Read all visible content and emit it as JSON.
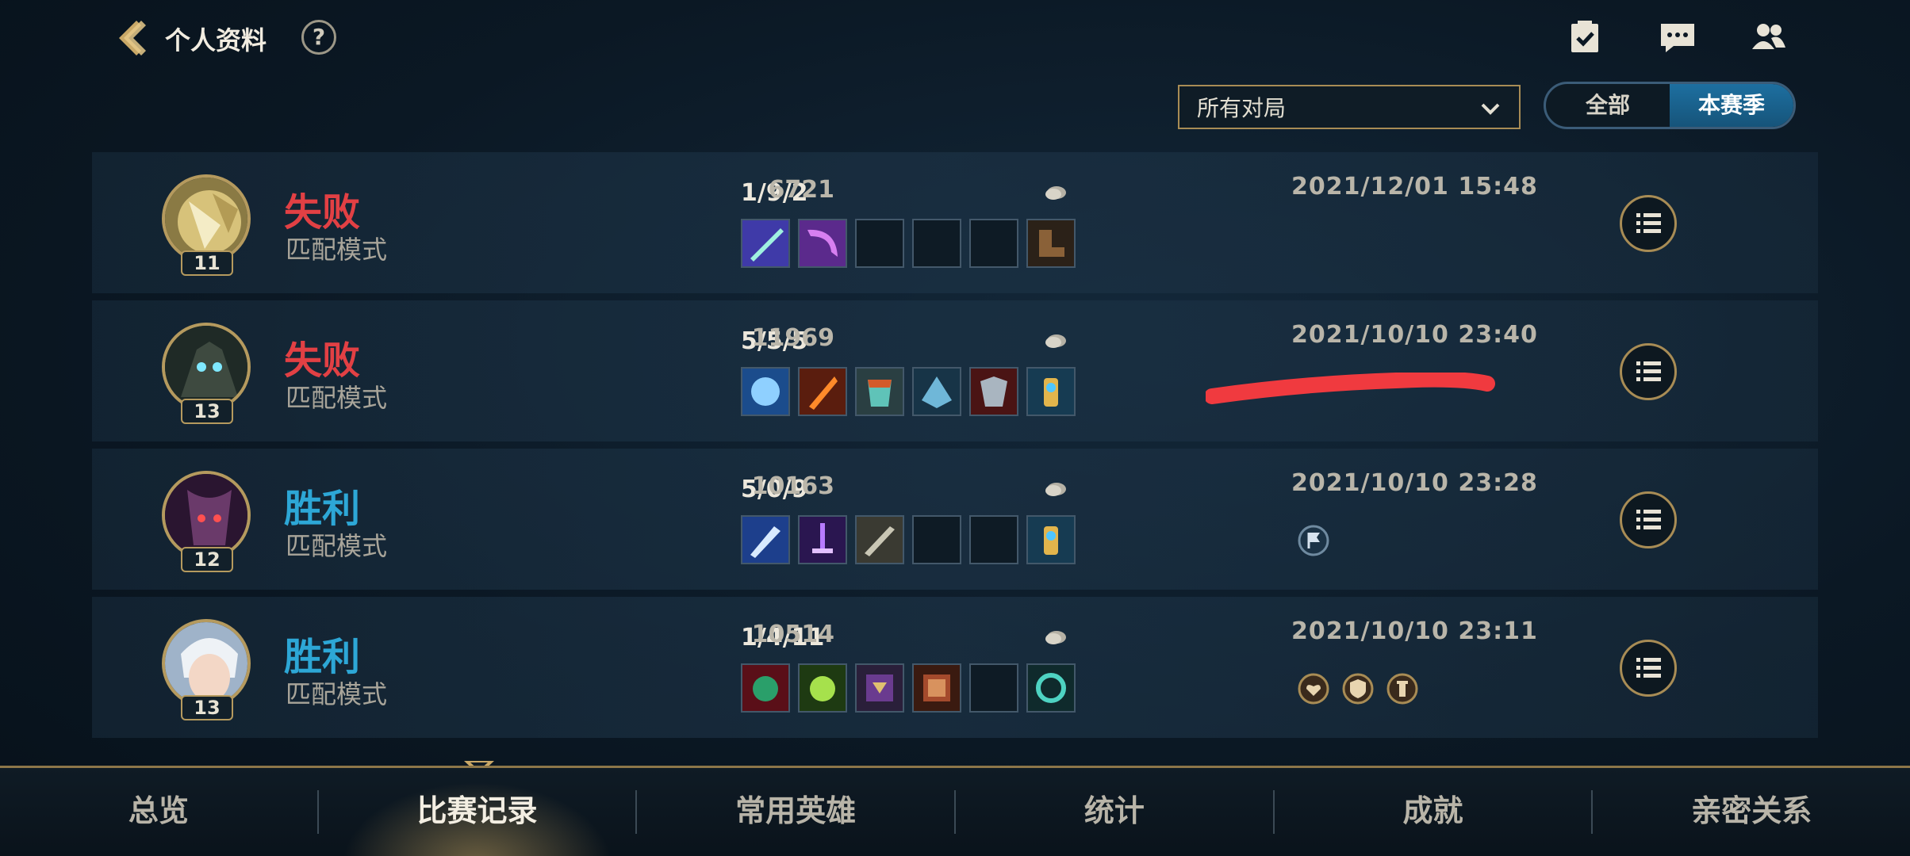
{
  "header": {
    "title": "个人资料",
    "help": "?"
  },
  "filter": {
    "selected": "所有对局",
    "season_options": [
      "全部",
      "本赛季"
    ],
    "season_active": "本赛季"
  },
  "matches": [
    {
      "result": "失败",
      "mode": "匹配模式",
      "level": "11",
      "kda": "1/9/2",
      "gold": "6721",
      "datetime": "2021/12/01 15:48",
      "items": [
        "item-blade-icon",
        "item-scythe-icon",
        "",
        "",
        "",
        "item-boots-icon"
      ],
      "badges": []
    },
    {
      "result": "失败",
      "mode": "匹配模式",
      "level": "13",
      "kda": "5/5/5",
      "gold": "11969",
      "datetime": "2021/10/10 23:40",
      "items": [
        "item-frost-gauntlet-icon",
        "item-flame-sword-icon",
        "item-scale-armor-icon",
        "item-ice-helm-icon",
        "item-red-armor-icon",
        "item-golden-trinket-icon"
      ],
      "badges": []
    },
    {
      "result": "胜利",
      "mode": "匹配模式",
      "level": "12",
      "kda": "5/0/9",
      "gold": "10163",
      "datetime": "2021/10/10 23:28",
      "items": [
        "item-crystal-blade-icon",
        "item-void-sword-icon",
        "item-longsword-icon",
        "",
        "",
        "item-golden-trinket-icon"
      ],
      "badges": [
        "flag-badge-icon"
      ]
    },
    {
      "result": "胜利",
      "mode": "匹配模式",
      "level": "13",
      "kda": "1/4/11",
      "gold": "10514",
      "datetime": "2021/10/10 23:11",
      "items": [
        "item-demon-mask-icon",
        "item-green-orb-icon",
        "item-purple-tome-icon",
        "item-red-tome-icon",
        "",
        "item-spiral-ward-icon"
      ],
      "badges": [
        "heart-badge-icon",
        "shield-badge-icon",
        "tower-badge-icon"
      ]
    }
  ],
  "tabs": [
    "总览",
    "比赛记录",
    "常用英雄",
    "统计",
    "成就",
    "亲密关系"
  ],
  "active_tab": "比赛记录",
  "colors": {
    "loss": "#e24044",
    "win": "#2da7d6",
    "gold_accent": "#b59a5e",
    "scribble": "#f03a3f"
  }
}
